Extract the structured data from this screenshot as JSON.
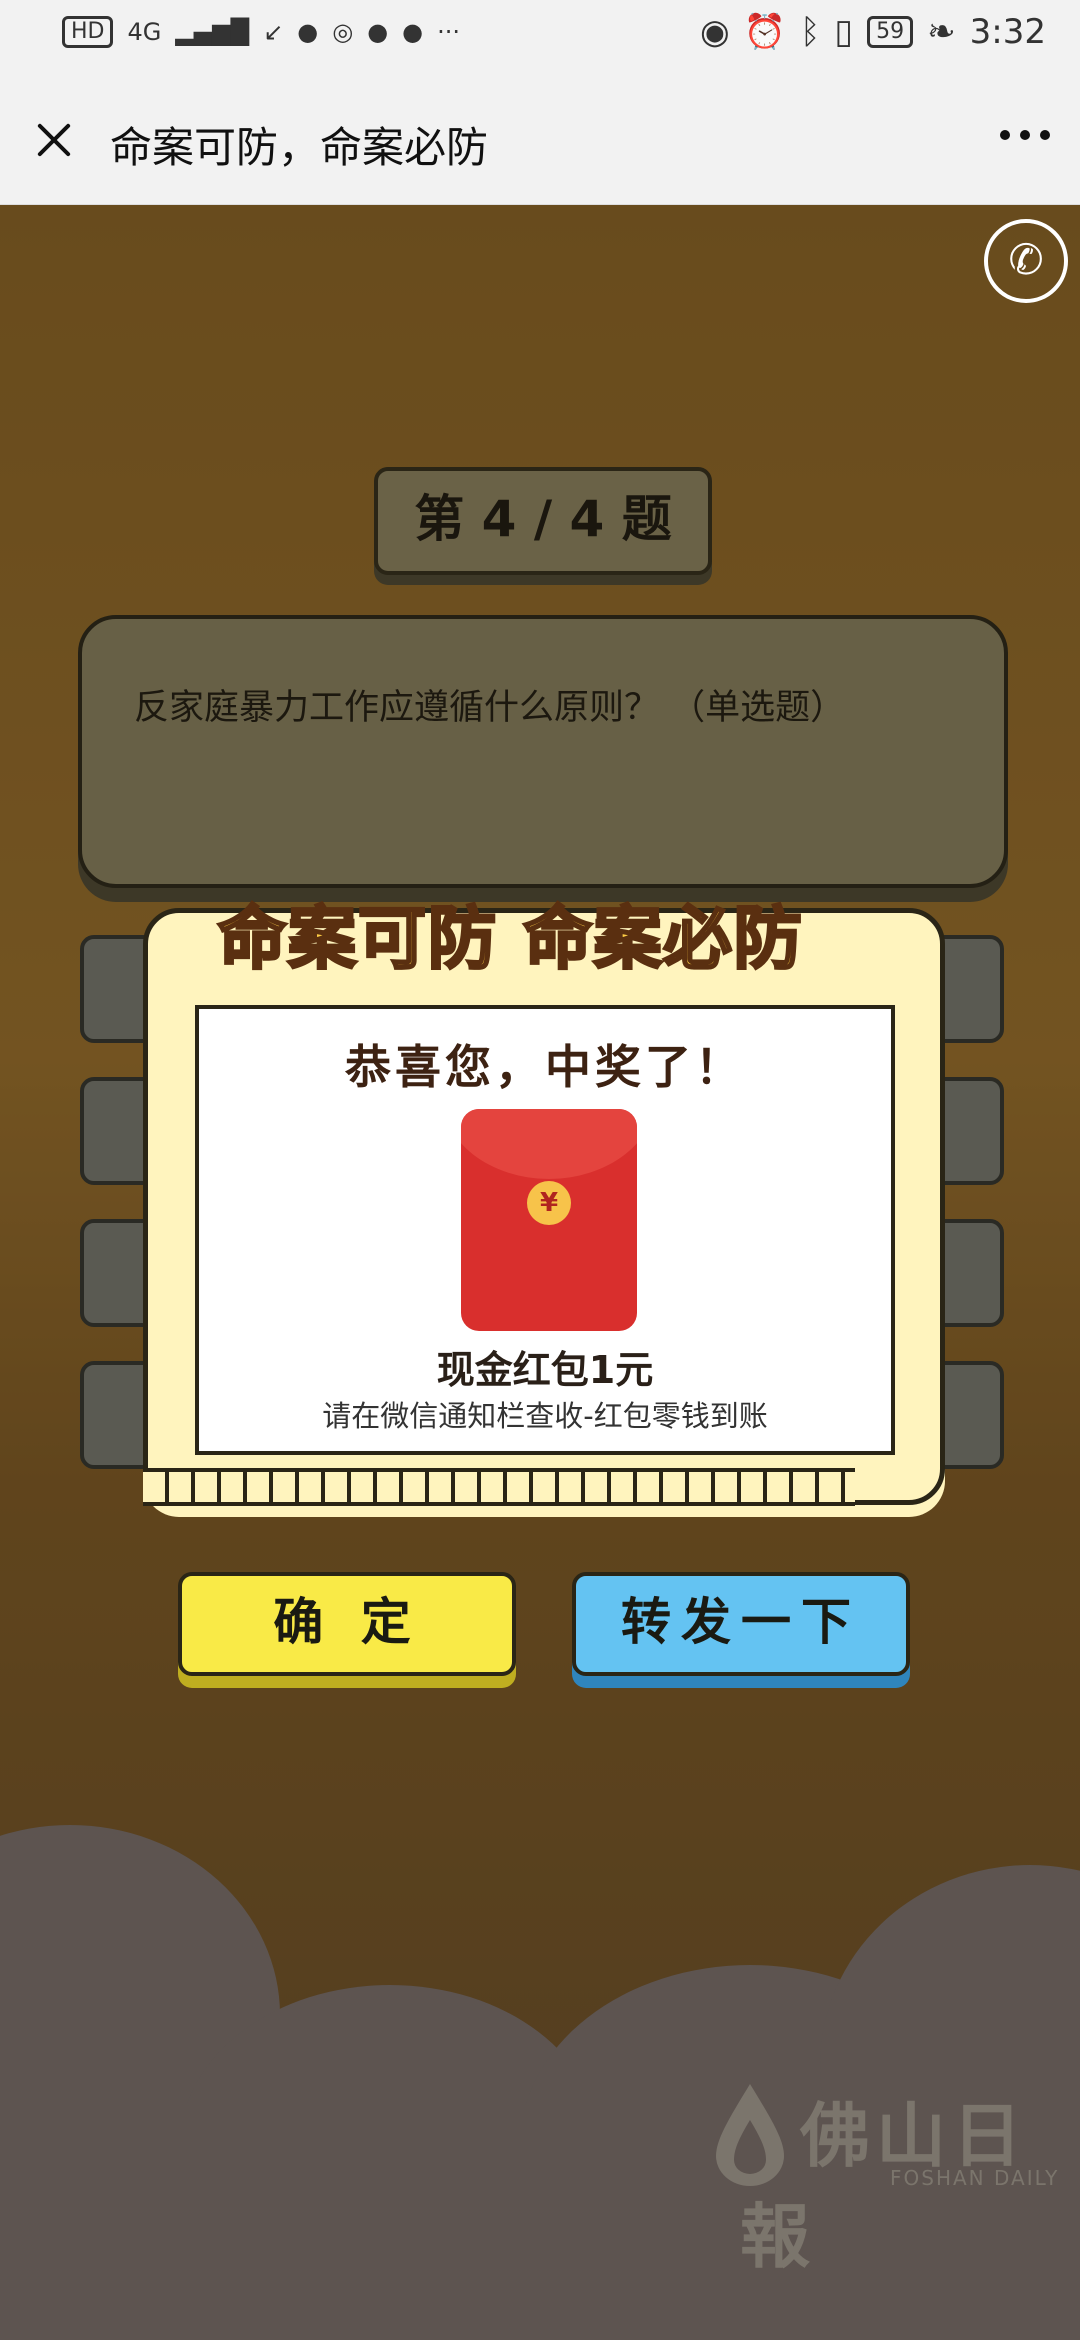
{
  "status_bar": {
    "left_indicators": [
      "HD",
      "4G"
    ],
    "battery": "59",
    "time": "3:32"
  },
  "title_bar": {
    "title": "命案可防，命案必防"
  },
  "quiz": {
    "question_number": "第 4 / 4 题",
    "question": "反家庭暴力工作应遵循什么原则？ （单选题）"
  },
  "modal": {
    "header": "命案可防 命案必防",
    "congrats": "恭喜您，中奖了！",
    "currency_symbol": "¥",
    "prize": "现金红包1元",
    "hint": "请在微信通知栏查收-红包零钱到账"
  },
  "buttons": {
    "confirm": "确 定",
    "share": "转发一下"
  },
  "watermark": {
    "name": "佛山日報",
    "name_en": "FOSHAN DAILY"
  },
  "colors": {
    "confirm_button": "#f9ea47",
    "share_button": "#64c3f2",
    "envelope": "#d92f2d",
    "modal_bg": "#fff4be"
  }
}
